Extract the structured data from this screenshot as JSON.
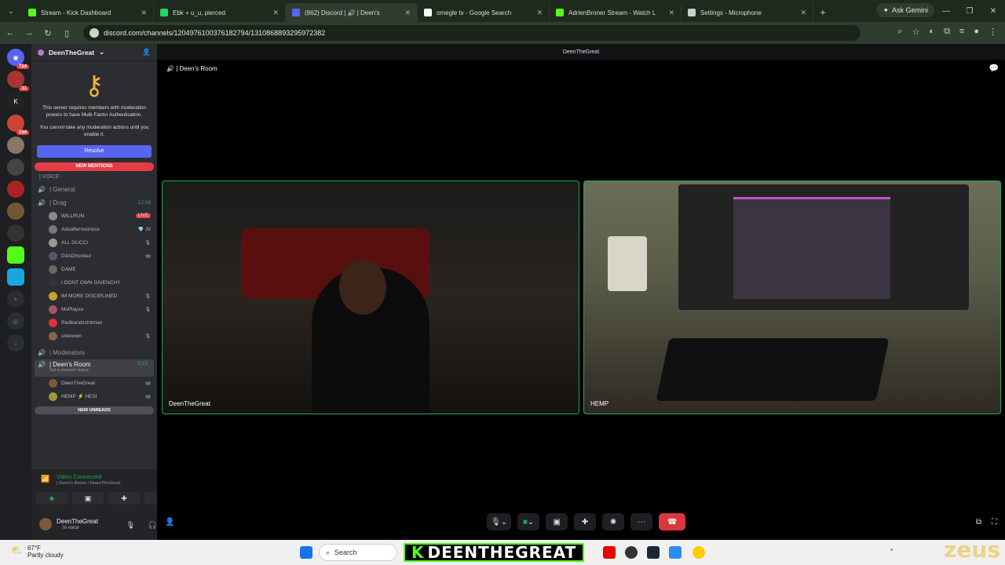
{
  "browser": {
    "tabs": [
      {
        "label": "Stream - Kick Dashboard",
        "icon": "kick-favicon",
        "color": "#53fc18"
      },
      {
        "label": "Ebk + u_u, pierced",
        "icon": "spotify-favicon",
        "color": "#1ed760"
      },
      {
        "label": "(862) Discord | 🔊 | Deen's",
        "icon": "discord-favicon",
        "color": "#5865f2",
        "active": true
      },
      {
        "label": "omegle tv - Google Search",
        "icon": "google-favicon",
        "color": "#ffffff"
      },
      {
        "label": "AdrienBroner Stream - Watch L",
        "icon": "kick-favicon",
        "color": "#53fc18"
      },
      {
        "label": "Settings - Microphone",
        "icon": "gear-favicon",
        "color": "#c8d0c8"
      }
    ],
    "gemini_label": "Ask Gemini",
    "url": "discord.com/channels/1204976100376182794/1310868893295972382"
  },
  "server": {
    "name": "DeenTheGreat",
    "mfa_text_1": "This server requires members with moderation powers to have Multi-Factor Authentication.",
    "mfa_text_2": "You cannot take any moderation actions until you enable it.",
    "resolve_label": "Resolve",
    "new_mentions_label": "NEW MENTIONS",
    "voice_category": "| VOICE -",
    "channels": [
      {
        "name": "| General",
        "time": ""
      },
      {
        "name": "| Drag",
        "time": "12:08"
      }
    ],
    "drag_members": [
      {
        "name": "WILLRUN",
        "extra": "LIVE",
        "color": "#888"
      },
      {
        "name": "Adoafternoonsss",
        "extra": "💎 JV",
        "color": "#777"
      },
      {
        "name": "ALL GUCCI",
        "extra": "🎙",
        "color": "#999"
      },
      {
        "name": "D3ADhomiez",
        "extra": "📹",
        "color": "#556"
      },
      {
        "name": "DAME",
        "extra": "",
        "color": "#666"
      },
      {
        "name": "I DONT OWN GIVENCHY",
        "extra": "",
        "color": "#333"
      },
      {
        "name": "IM MORE DISCIPLINED",
        "extra": "🎙",
        "color": "#c9a227"
      },
      {
        "name": "MsPlayxo",
        "extra": "🎙",
        "color": "#a56"
      },
      {
        "name": "Redbandzchitman",
        "extra": "",
        "color": "#d33"
      },
      {
        "name": "unknown",
        "extra": "🎙",
        "color": "#864"
      }
    ],
    "moderators_label": "| Moderators",
    "active_channel": {
      "name": "| Deen's Room",
      "time": "9:13",
      "status": "Set a channel status"
    },
    "room_members": [
      {
        "name": "DeenTheGreat",
        "extra": "📹",
        "color": "#7a5a3a"
      },
      {
        "name": "HEMP ⚡ HESI",
        "extra": "📹",
        "color": "#9a9a40"
      }
    ],
    "new_unreads_label": "NEW UNREADS"
  },
  "server_badges": [
    "724",
    "31",
    "154"
  ],
  "voice": {
    "status": "Video Connected",
    "location": "| Deen's Room / DeenTheGreat"
  },
  "user": {
    "name": "DeenTheGreat",
    "status": "In voice"
  },
  "call": {
    "header_title": "DeenTheGreat",
    "room_title": "| Deen's Room",
    "tile1_name": "DeenTheGreat",
    "tile2_name": "HEMP"
  },
  "taskbar": {
    "temp": "67°F",
    "weather": "Partly cloudy",
    "search_placeholder": "Search",
    "overlay_text": "DEENTHEGREAT"
  },
  "watermark": "zeus"
}
